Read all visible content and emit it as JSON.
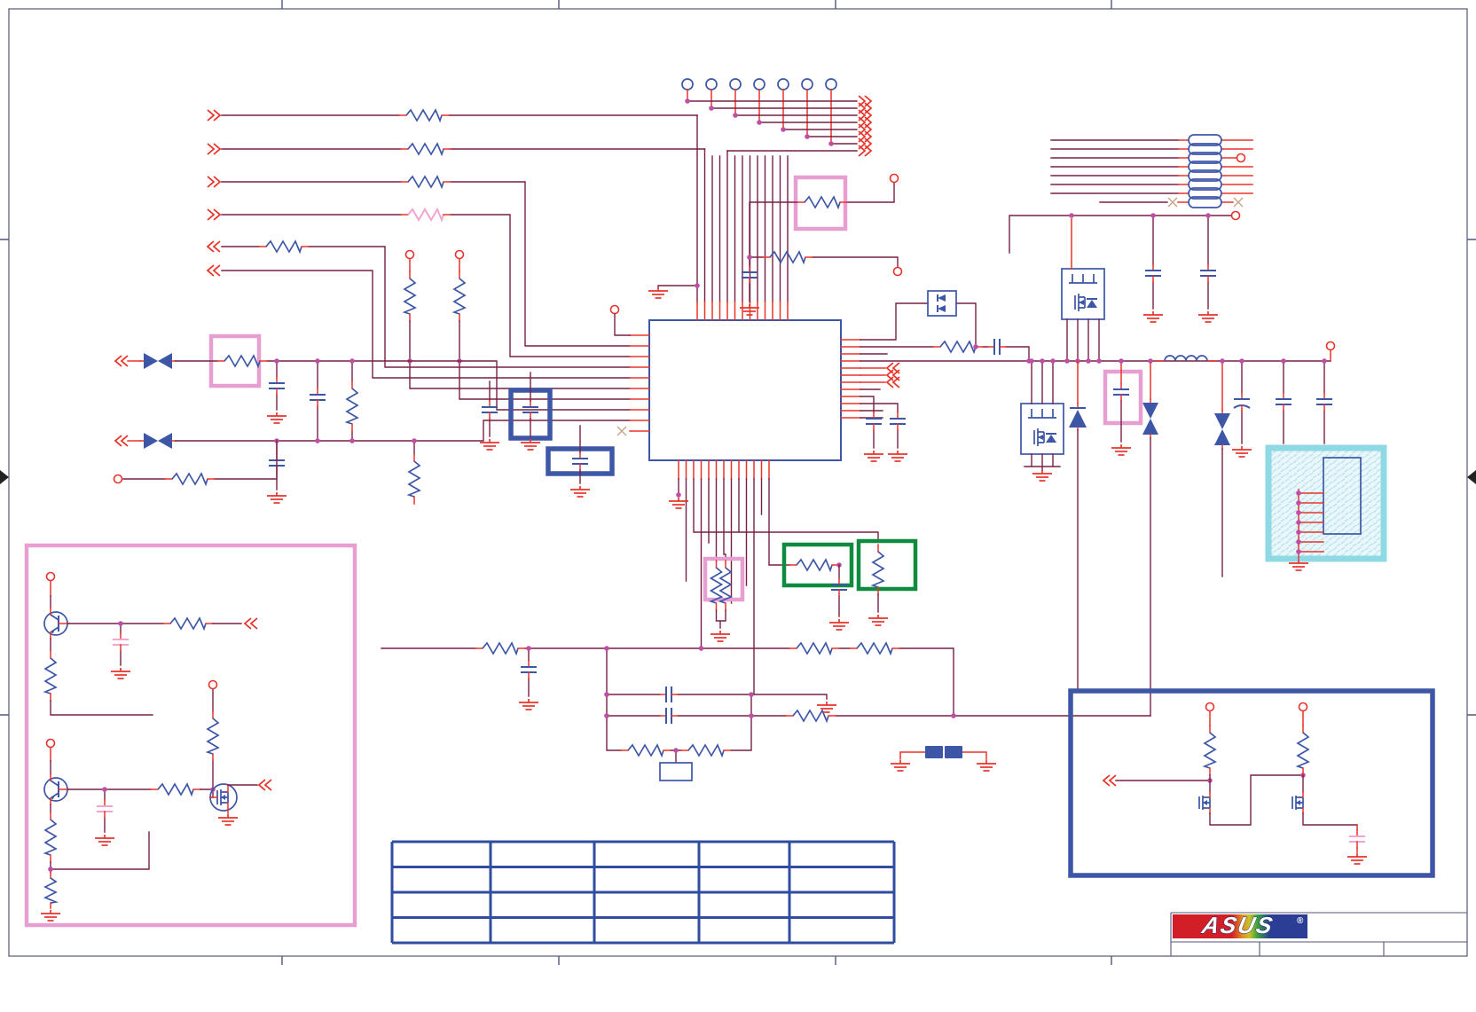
{
  "document": {
    "kind": "circuit-schematic-sheet",
    "brand": "ASUS"
  },
  "logo": {
    "brand": "ASUS",
    "registered": "®"
  },
  "colors": {
    "wire": "#772045",
    "red": "#E8332A",
    "blue": "#3D56A6",
    "junction": "#BE4FA5",
    "pink": "#E79FD2",
    "pinkel": "#F2A6CF",
    "green": "#0F8A41",
    "teal": "#8FD9E5",
    "tealfill": "#E9F6FA",
    "tealhatch": "#B5E2EF",
    "frame": "#55557A",
    "tableblue": "#2F4EA0",
    "nc": "#C9A68A",
    "logored": "#D21E26",
    "logoblue": "#2B3D94"
  },
  "revision_table": {
    "rows": 4,
    "columns": 5,
    "cells": [
      [
        "",
        "",
        "",
        "",
        ""
      ],
      [
        "",
        "",
        "",
        "",
        ""
      ],
      [
        "",
        "",
        "",
        "",
        ""
      ],
      [
        "",
        "",
        "",
        "",
        ""
      ]
    ]
  },
  "title_block": {
    "fields": [
      "",
      "",
      ""
    ]
  },
  "counts": {
    "top_test_points": 7,
    "top_net_arrows": 8,
    "resistor_network_pills": 8,
    "teal_connector_pins": 7,
    "left_input_arrows": 6,
    "bottom_left_transistors": 2,
    "bottom_right_mosfets": 2
  }
}
